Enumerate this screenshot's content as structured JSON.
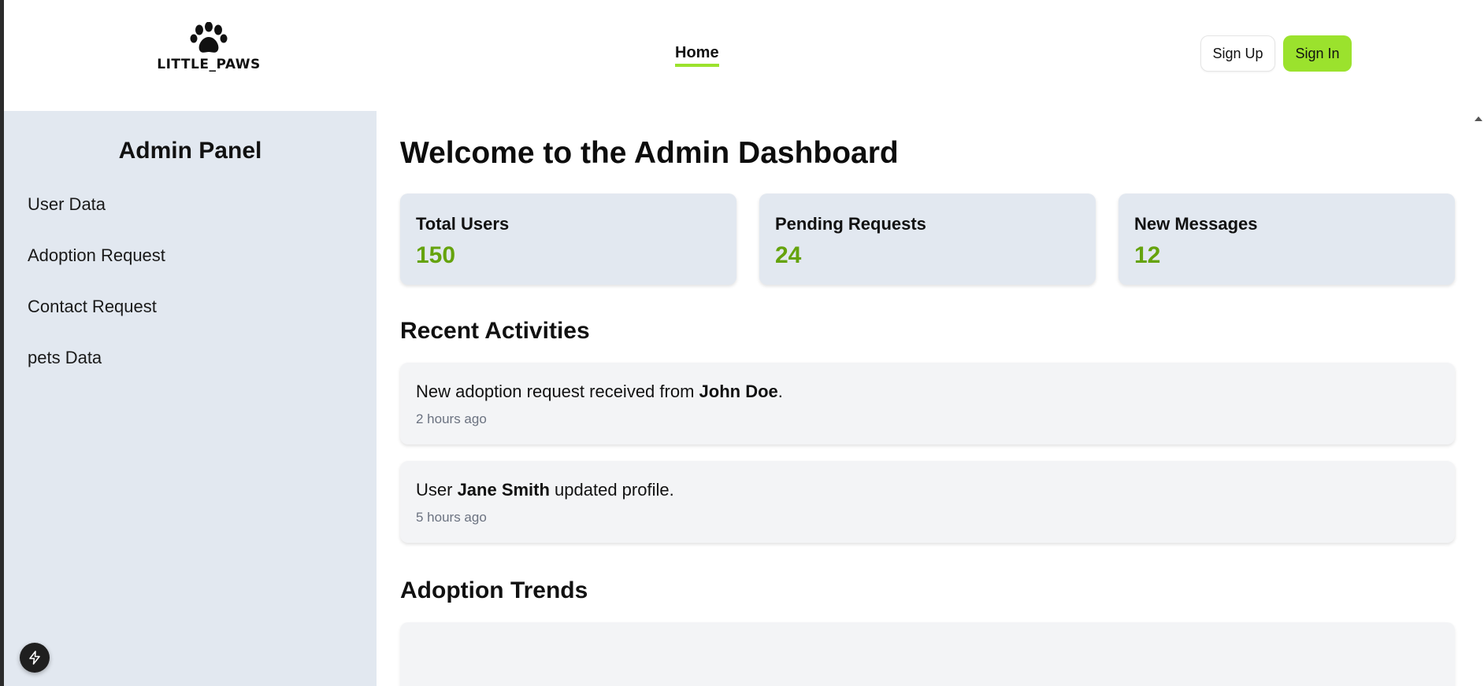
{
  "header": {
    "logo_text": "LITTLE_PAWS",
    "nav_home": "Home",
    "signup_label": "Sign Up",
    "signin_label": "Sign In"
  },
  "sidebar": {
    "title": "Admin Panel",
    "items": [
      {
        "label": "User Data"
      },
      {
        "label": "Adoption Request"
      },
      {
        "label": "Contact Request"
      },
      {
        "label": "pets Data"
      }
    ]
  },
  "main": {
    "title": "Welcome to the Admin Dashboard",
    "stats": [
      {
        "label": "Total Users",
        "value": "150"
      },
      {
        "label": "Pending Requests",
        "value": "24"
      },
      {
        "label": "New Messages",
        "value": "12"
      }
    ],
    "recent_title": "Recent Activities",
    "activities": [
      {
        "prefix": "New adoption request received from ",
        "name": "John Doe",
        "suffix": ".",
        "time": "2 hours ago"
      },
      {
        "prefix": "User ",
        "name": "Jane Smith",
        "suffix": " updated profile.",
        "time": "5 hours ago"
      }
    ],
    "trends_title": "Adoption Trends"
  },
  "colors": {
    "accent": "#9be22d",
    "stat_value": "#65a30d",
    "sidebar_bg": "#e2e8f0",
    "card_bg": "#f3f4f6"
  },
  "icons": {
    "logo": "paw-icon",
    "fab": "bolt-icon"
  }
}
